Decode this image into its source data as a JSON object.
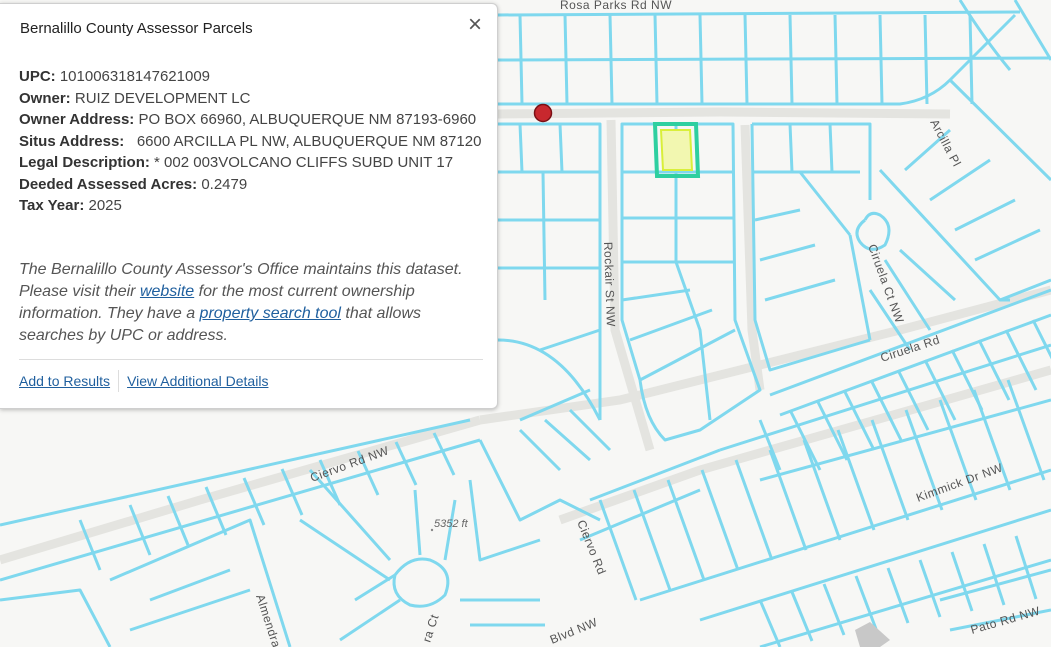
{
  "popup": {
    "title": "Bernalillo County Assessor Parcels",
    "close_symbol": "×",
    "fields": [
      {
        "label": "UPC:",
        "value": " 101006318147621009"
      },
      {
        "label": "Owner:",
        "value": " RUIZ DEVELOPMENT LC"
      },
      {
        "label": "Owner Address:",
        "value": " PO BOX 66960, ALBUQUERQUE NM 87193-6960"
      },
      {
        "label": "Situs Address:",
        "value": "   6600 ARCILLA PL NW, ALBUQUERQUE NM 87120"
      },
      {
        "label": "Legal Description:",
        "value": " * 002 003VOLCANO CLIFFS SUBD UNIT 17"
      },
      {
        "label": "Deeded Assessed Acres:",
        "value": " 0.2479"
      },
      {
        "label": "Tax Year:",
        "value": " 2025"
      }
    ],
    "description": {
      "part1": "The Bernalillo County Assessor's Office maintains this dataset. Please visit their ",
      "link1": "website",
      "part2": " for the most current ownership information. They have a ",
      "link2": "property search tool",
      "part3": " that allows searches by UPC or address."
    },
    "actions": {
      "add_to_results": "Add to Results",
      "view_details": "View Additional Details"
    }
  },
  "map": {
    "parcel_color": "#7fd8ee",
    "highlight_color": "#2ecfa0",
    "selected_fill": "#f2f7b0",
    "marker_color": "#c8282e",
    "street_labels": {
      "rosa_parks": "Rosa Parks Rd NW",
      "rosa_parks_top": "Rosa Parks Rd NW",
      "arcilla": "Arcilla Pl",
      "rockair": "Rockair St NW",
      "ciruela_ct": "Ciruela Ct NW",
      "ciruela_rd": "Ciruela Rd",
      "ciervo_rd_nw": "Ciervo Rd NW",
      "ciervo_rd": "Ciervo Rd",
      "kimmick": "Kimmick Dr NW",
      "almendra": "Almendra",
      "ra_ct": "ra Ct",
      "blvd": "Blvd NW",
      "pato": "Pato Rd NW"
    },
    "elevation": "5352 ft"
  }
}
